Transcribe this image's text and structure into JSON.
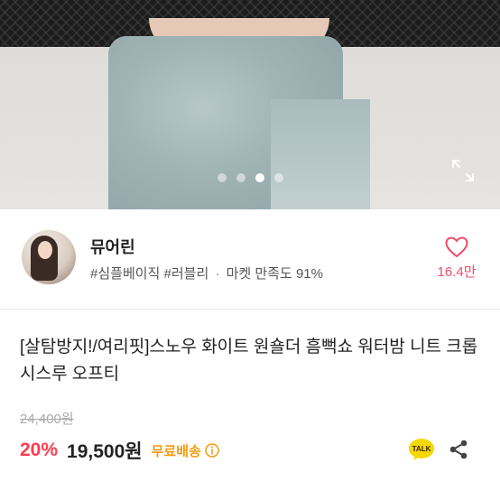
{
  "gallery": {
    "image_alt": "",
    "dot_count": 4,
    "active_index": 2
  },
  "seller": {
    "name": "뮤어린",
    "tag1": "#심플베이직",
    "tag2": "#러블리",
    "separator": "·",
    "satisfaction": "마켓 만족도 91%",
    "like_count": "16.4만"
  },
  "product": {
    "title": "[살탐방지!/여리핏]스노우 화이트 원숄더 흠뻑쇼 워터밤 니트 크롭 시스루 오프티",
    "original_price": "24,400원",
    "discount": "20%",
    "price": "19,500원",
    "shipping": "무료배송"
  },
  "icons": {
    "expand": "expand-icon",
    "heart": "heart-icon",
    "info": "info-icon",
    "talk": "kakao-talk-icon",
    "share": "share-icon"
  },
  "colors": {
    "accent_pink": "#ee4b6a",
    "discount_red": "#ff3b4e",
    "shipping_orange": "#f39c12",
    "talk_yellow": "#f5d800"
  }
}
